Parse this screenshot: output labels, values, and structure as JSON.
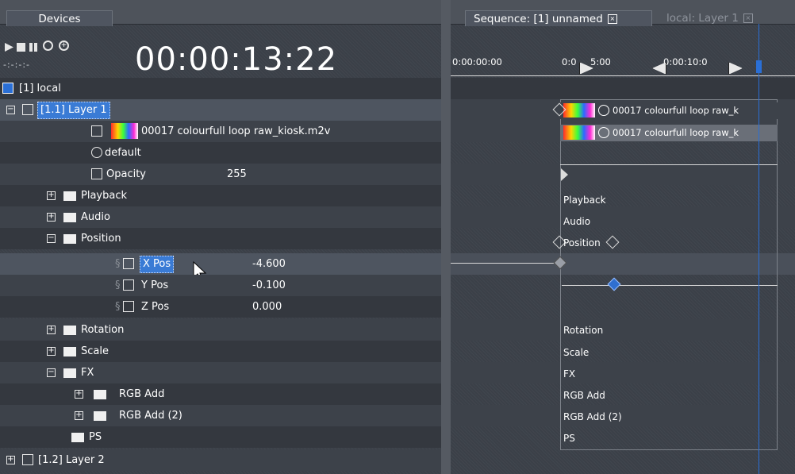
{
  "devices_panel": {
    "tab_label": "Devices"
  },
  "transport": {
    "timecode": "00:00:13:22",
    "sub_timecode": "-:-:-:-"
  },
  "tree": {
    "device": "[1] local",
    "layer1": "[1.1] Layer 1",
    "media_file": "00017 colourfull loop raw_kiosk.m2v",
    "default_label": "default",
    "opacity_label": "Opacity",
    "opacity_value": "255",
    "playback": "Playback",
    "audio": "Audio",
    "position": "Position",
    "xpos_label": "X Pos",
    "xpos_value": "-4.600",
    "ypos_label": "Y Pos",
    "ypos_value": "-0.100",
    "zpos_label": "Z Pos",
    "zpos_value": "0.000",
    "rotation": "Rotation",
    "scale": "Scale",
    "fx": "FX",
    "rgb_add": "RGB Add",
    "rgb_add2": "RGB Add (2)",
    "ps": "PS",
    "layer2": "[1.2] Layer 2"
  },
  "sequence": {
    "tab_active": "Sequence: [1] unnamed",
    "tab_inactive": "local: Layer 1",
    "time_labels": [
      "0:00:00:00",
      "0:0",
      "5:00",
      "0:00:10:0"
    ],
    "clip_label": "00017 colourfull loop raw_k",
    "track_labels": {
      "playback": "Playback",
      "audio": "Audio",
      "position": "Position",
      "rotation": "Rotation",
      "scale": "Scale",
      "fx": "FX",
      "rgb_add": "RGB Add",
      "rgb_add2": "RGB Add (2)",
      "ps": "PS"
    }
  },
  "colors": {
    "accent": "#3a7bd5",
    "keyframe": "#2f6fd0",
    "background": "#3b4048"
  }
}
